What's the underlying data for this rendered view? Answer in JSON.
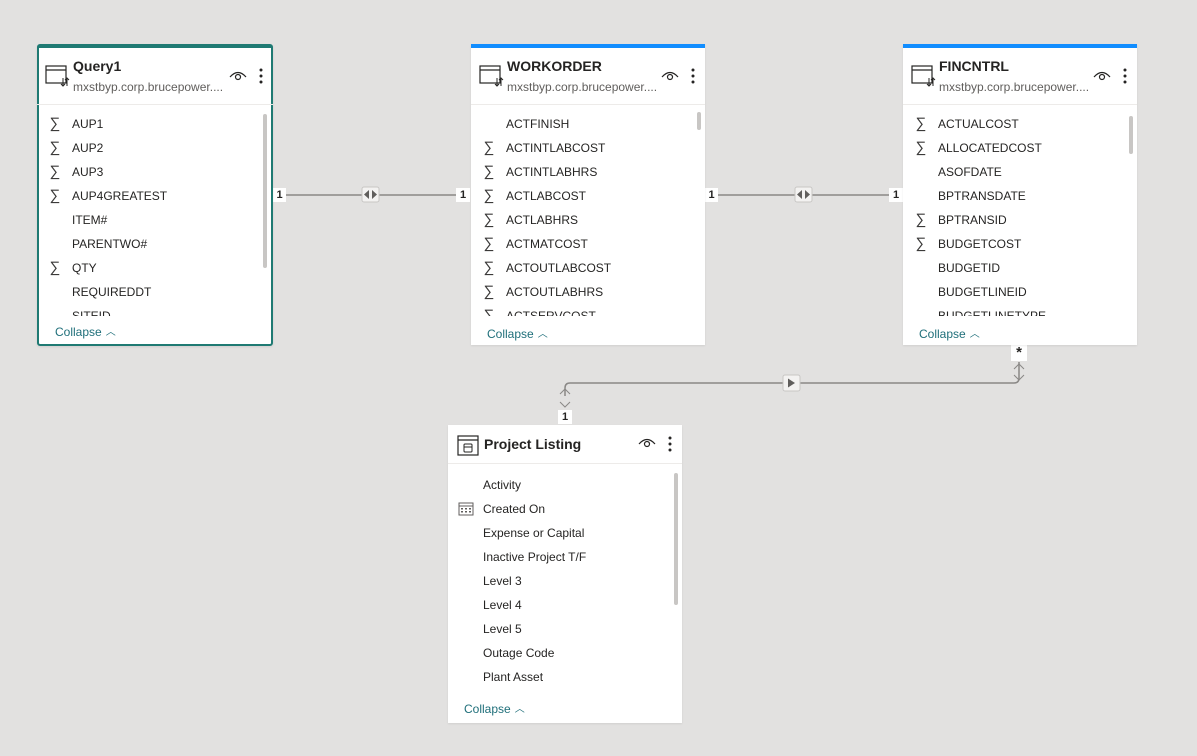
{
  "tables": {
    "query1": {
      "title": "Query1",
      "source": "mxstbyp.corp.brucepower....",
      "fields": [
        {
          "label": "AUP1",
          "icon": "sigma"
        },
        {
          "label": "AUP2",
          "icon": "sigma"
        },
        {
          "label": "AUP3",
          "icon": "sigma"
        },
        {
          "label": "AUP4GREATEST",
          "icon": "sigma"
        },
        {
          "label": "ITEM#",
          "icon": ""
        },
        {
          "label": "PARENTWO#",
          "icon": ""
        },
        {
          "label": "QTY",
          "icon": "sigma"
        },
        {
          "label": "REQUIREDDT",
          "icon": ""
        },
        {
          "label": "SITEID",
          "icon": ""
        }
      ],
      "collapse": "Collapse"
    },
    "workorder": {
      "title": "WORKORDER",
      "source": "mxstbyp.corp.brucepower....",
      "fields": [
        {
          "label": "ACTFINISH",
          "icon": ""
        },
        {
          "label": "ACTINTLABCOST",
          "icon": "sigma"
        },
        {
          "label": "ACTINTLABHRS",
          "icon": "sigma"
        },
        {
          "label": "ACTLABCOST",
          "icon": "sigma"
        },
        {
          "label": "ACTLABHRS",
          "icon": "sigma"
        },
        {
          "label": "ACTMATCOST",
          "icon": "sigma"
        },
        {
          "label": "ACTOUTLABCOST",
          "icon": "sigma"
        },
        {
          "label": "ACTOUTLABHRS",
          "icon": "sigma"
        },
        {
          "label": "ACTSERVCOST",
          "icon": "sigma"
        }
      ],
      "collapse": "Collapse"
    },
    "fincntrl": {
      "title": "FINCNTRL",
      "source": "mxstbyp.corp.brucepower....",
      "fields": [
        {
          "label": "ACTUALCOST",
          "icon": "sigma"
        },
        {
          "label": "ALLOCATEDCOST",
          "icon": "sigma"
        },
        {
          "label": "ASOFDATE",
          "icon": ""
        },
        {
          "label": "BPTRANSDATE",
          "icon": ""
        },
        {
          "label": "BPTRANSID",
          "icon": "sigma"
        },
        {
          "label": "BUDGETCOST",
          "icon": "sigma"
        },
        {
          "label": "BUDGETID",
          "icon": ""
        },
        {
          "label": "BUDGETLINEID",
          "icon": ""
        },
        {
          "label": "BUDGETLINETYPE",
          "icon": ""
        }
      ],
      "collapse": "Collapse"
    },
    "project_listing": {
      "title": "Project Listing",
      "fields": [
        {
          "label": "Activity",
          "icon": ""
        },
        {
          "label": "Created On",
          "icon": "calendar"
        },
        {
          "label": "Expense or Capital",
          "icon": ""
        },
        {
          "label": "Inactive Project T/F",
          "icon": ""
        },
        {
          "label": "Level 3",
          "icon": ""
        },
        {
          "label": "Level 4",
          "icon": ""
        },
        {
          "label": "Level 5",
          "icon": ""
        },
        {
          "label": "Outage Code",
          "icon": ""
        },
        {
          "label": "Plant Asset",
          "icon": ""
        }
      ],
      "collapse": "Collapse"
    }
  },
  "relationships": [
    {
      "from": "Query1",
      "to": "WORKORDER",
      "from_card": "1",
      "to_card": "1",
      "direction": "both"
    },
    {
      "from": "WORKORDER",
      "to": "FINCNTRL",
      "from_card": "1",
      "to_card": "1",
      "direction": "both"
    },
    {
      "from": "Project Listing",
      "to": "FINCNTRL",
      "from_card": "1",
      "to_card": "*",
      "direction": "single"
    }
  ],
  "colors": {
    "canvas": "#e2e1e0",
    "card_top_border": "#118dff",
    "selected_border": "#1f7a73",
    "collapse_link": "#1f6f7a",
    "line": "#8a8886"
  }
}
